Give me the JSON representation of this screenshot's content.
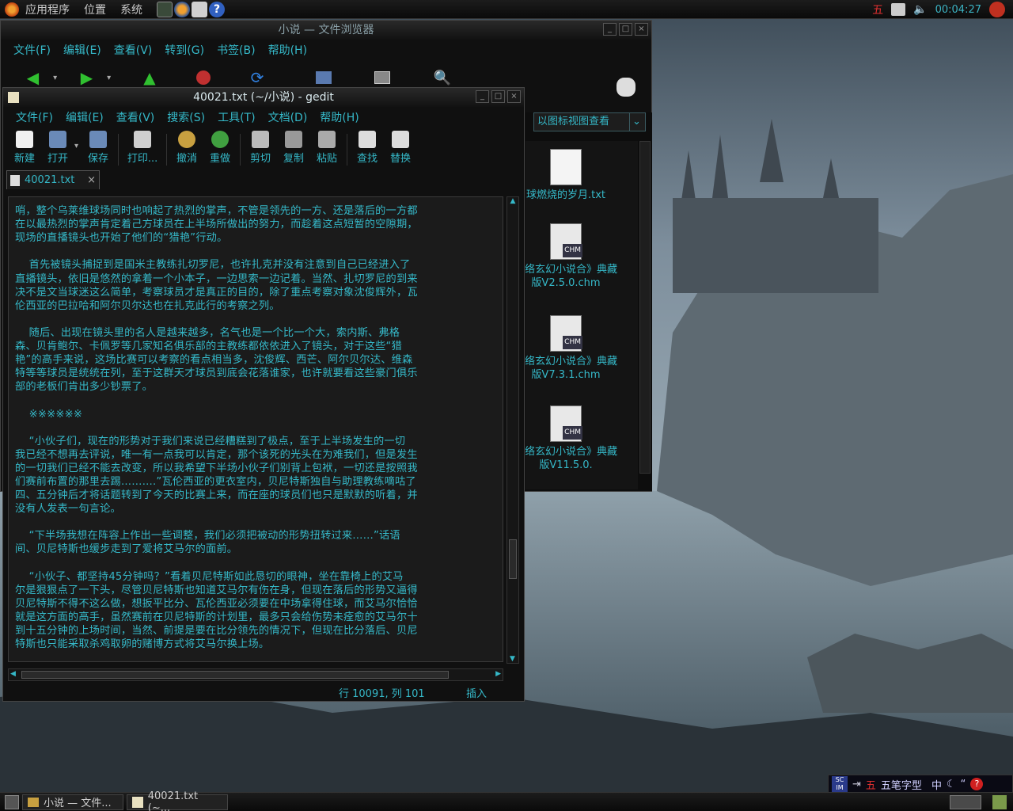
{
  "top_panel": {
    "menus": [
      "应用程序",
      "位置",
      "系统"
    ],
    "clock": "00:04:27"
  },
  "file_browser": {
    "title": "小说 — 文件浏览器",
    "menu": [
      "文件(F)",
      "编辑(E)",
      "查看(V)",
      "转到(G)",
      "书签(B)",
      "帮助(H)"
    ],
    "view_mode": "以图标视图查看",
    "files": [
      {
        "name": "球燃烧的岁月.txt",
        "type": "txt"
      },
      {
        "name": "网络玄幻小说合》典藏版V2.5.0.chm",
        "type": "chm"
      },
      {
        "name": "网络玄幻小说合》典藏版V7.3.1.chm",
        "type": "chm"
      },
      {
        "name": "网络玄幻小说合》典藏版V11.5.0.",
        "type": "chm"
      }
    ]
  },
  "gedit": {
    "title": "40021.txt (~/小说) - gedit",
    "menu": [
      "文件(F)",
      "编辑(E)",
      "查看(V)",
      "搜索(S)",
      "工具(T)",
      "文档(D)",
      "帮助(H)"
    ],
    "toolbar": [
      "新建",
      "打开",
      "保存",
      "打印...",
      "撤消",
      "重做",
      "剪切",
      "复制",
      "粘贴",
      "查找",
      "替换"
    ],
    "tab_label": "40021.txt",
    "lines": [
      "哨，整个乌莱维球场同时也响起了热烈的掌声，不管是领先的一方、还是落后的一方都",
      "在以最热烈的掌声肯定着己方球员在上半场所做出的努力，而趁着这点短暂的空隙期，",
      "现场的直播镜头也开始了他们的“猎艳”行动。",
      "",
      "    首先被镜头捕捉到是国米主教练扎切罗尼，也许扎克并没有注意到自己已经进入了",
      "直播镜头，依旧是悠然的拿着一个小本子，一边思索一边记着。当然、扎切罗尼的到来",
      "决不是文当球迷这么简单，考察球员才是真正的目的，除了重点考察对象沈俊辉外，瓦",
      "伦西亚的巴拉哈和阿尔贝尔达也在扎克此行的考察之列。",
      "",
      "    随后、出现在镜头里的名人是越来越多，名气也是一个比一个大，索内斯、弗格",
      "森、贝肯鲍尔、卡佩罗等几家知名俱乐部的主教练都依依进入了镜头，对于这些“猎",
      "艳”的高手来说，这场比赛可以考察的看点相当多，沈俊辉、西芒、阿尔贝尔达、维森",
      "特等等球员是统统在列，至于这群天才球员到底会花落谁家，也许就要看这些豪门俱乐",
      "部的老板们肯出多少钞票了。",
      "",
      "    ※※※※※※",
      "",
      "    “小伙子们，现在的形势对于我们来说已经糟糕到了极点，至于上半场发生的一切",
      "我已经不想再去评说，唯一有一点我可以肯定，那个该死的光头在为难我们，但是发生",
      "的一切我们已经不能去改变，所以我希望下半场小伙子们别背上包袱，一切还是按照我",
      "们赛前布置的那里去踢……….”瓦伦西亚的更衣室内，贝尼特斯独自与助理教练嘀咕了",
      "四、五分钟后才将话题转到了今天的比赛上来，而在座的球员们也只是默默的听着，并",
      "没有人发表一句言论。",
      "",
      "    “下半场我想在阵容上作出一些调整，我们必须把被动的形势扭转过来……”话语",
      "间、贝尼特斯也缓步走到了爱将艾马尔的面前。",
      "",
      "    “小伙子、都坚持45分钟吗？”看着贝尼特斯如此恳切的眼神，坐在靠椅上的艾马",
      "尔是狠狠点了一下头，尽管贝尼特斯也知道艾马尔有伤在身，但现在落后的形势又逼得",
      "贝尼特斯不得不这么做，想扳平比分、瓦伦西亚必须要在中场拿得住球，而艾马尔恰恰",
      "就是这方面的高手，虽然赛前在贝尼特斯的计划里，最多只会给伤势未痊愈的艾马尔十",
      "到十五分钟的上场时间，当然、前提是要在比分领先的情况下，但现在比分落后、贝尼",
      "特斯也只能采取杀鸡取卵的赌博方式将艾马尔换上场。"
    ],
    "status_position": "行 10091, 列 101",
    "status_mode": "插入"
  },
  "taskbar": {
    "tasks": [
      "小说 — 文件...",
      "40021.txt (~..."
    ]
  },
  "ime": {
    "mode": "五",
    "input_method": "五笔字型",
    "lang": "中"
  }
}
